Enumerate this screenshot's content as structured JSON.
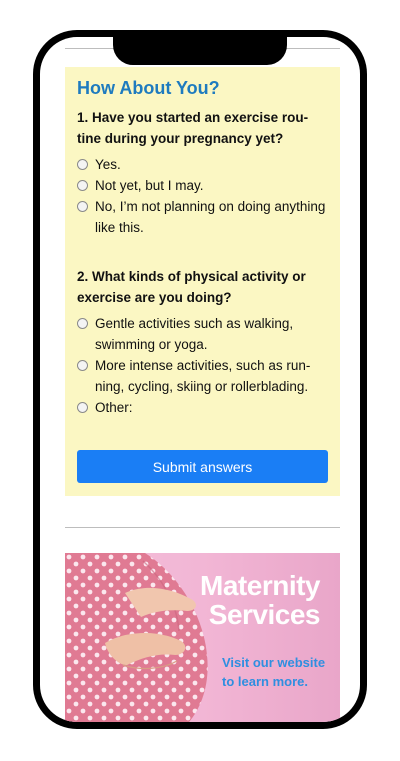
{
  "quiz": {
    "title": "How About You?",
    "q1": {
      "text": "1. Have you started an exercise rou-tine during your pregnancy yet?",
      "options": [
        "Yes.",
        "Not yet, but I may.",
        "No, I’m not planning on doing anything like this."
      ]
    },
    "q2": {
      "text": "2. What kinds of physical activity or exercise are you doing?",
      "options": [
        "Gentle activities such as walking, swimming or yoga.",
        "More intense activities, such as run-ning, cycling, skiing or rollerblading.",
        "Other:"
      ]
    },
    "submit_label": "Submit answers"
  },
  "ad": {
    "title": "Maternity Services",
    "cta": "Visit our website to learn more."
  },
  "colors": {
    "quiz_bg": "#fbf7c3",
    "title": "#1e7bbf",
    "button": "#1a7ef5",
    "ad_bg": "#f2b6d5",
    "ad_cta": "#2f8fe0"
  },
  "icons": [
    "radio-button-icon"
  ]
}
